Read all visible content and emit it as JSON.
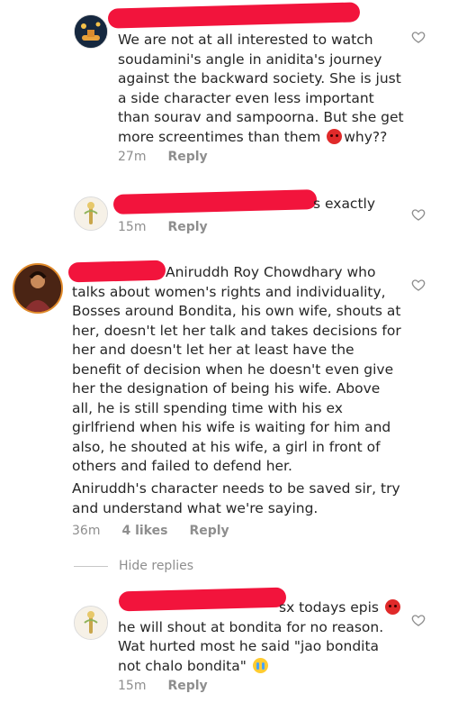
{
  "comments": [
    {
      "user": "",
      "text": "We are not at all interested to watch soudamini's angle in anidita's journey against the backward society. She is just a side character even less important than sourav and sampoorna. But she get more screentimes than them",
      "text_end": "why??",
      "time": "27m",
      "reply_label": "Reply"
    },
    {
      "user": "",
      "text": "s exactly",
      "time": "15m",
      "reply_label": "Reply"
    },
    {
      "user": "",
      "text": "Aniruddh Roy Chowdhary who talks about women's rights and individuality, Bosses around Bondita, his own wife, shouts at her, doesn't let her talk and takes decisions for her and doesn't let her at least have the benefit of decision when he doesn't even give her the designation of being his wife. Above all, he is still spending time with his ex girlfriend when his wife is waiting for him and also, he shouted at his wife, a girl in front of others and failed to defend her.",
      "text_para2": "Aniruddh's character needs to be saved sir, try and understand what we're saying.",
      "time": "36m",
      "likes": "4 likes",
      "reply_label": "Reply"
    },
    {
      "user": "",
      "text": "sx todays epis",
      "text_cont": "he will shout at bondita for no reason. Wat hurted most he said \"jao bondita not chalo bondita\"",
      "time": "15m",
      "reply_label": "Reply"
    }
  ],
  "hide_replies_label": "Hide replies",
  "colors": {
    "redaction": "#f2143c",
    "meta": "#8e8e8e",
    "text": "#262626"
  }
}
